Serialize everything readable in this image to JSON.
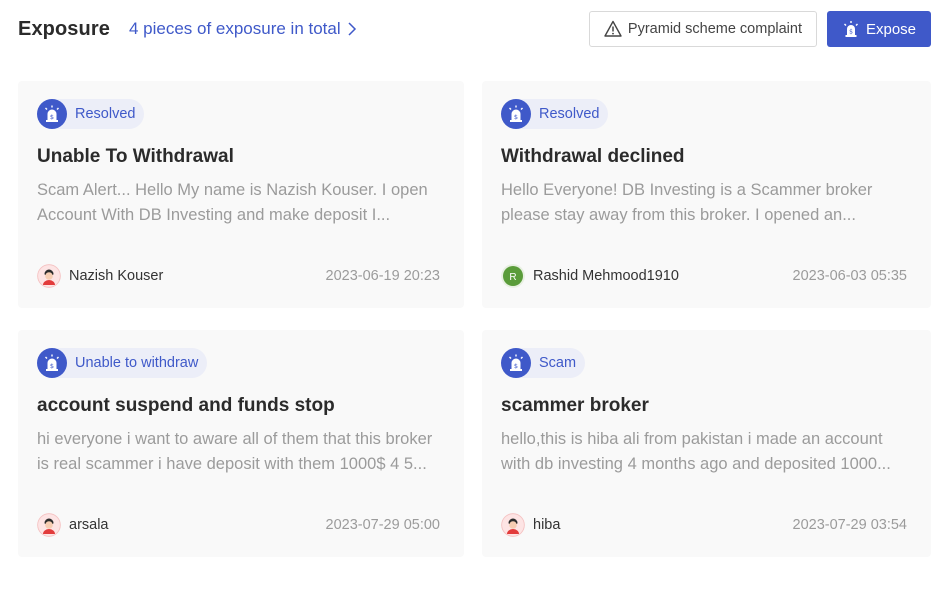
{
  "header": {
    "title": "Exposure",
    "total_link": "4 pieces of exposure in total",
    "complaint_button": "Pyramid scheme complaint",
    "expose_button": "Expose"
  },
  "colors": {
    "accent": "#3f59c9",
    "badge_bg": "#eceef8",
    "card_bg": "#f9f9f9",
    "muted_text": "#9b9b9b",
    "avatar_letter_bg": "#5a9c3a"
  },
  "cards": [
    {
      "status": "Resolved",
      "title": "Unable To Withdrawal",
      "description": "Scam Alert... Hello My name is Nazish Kouser. I open Account With DB Investing and make deposit I...",
      "author": "Nazish Kouser",
      "avatar_type": "person-icon",
      "date": "2023-06-19 20:23"
    },
    {
      "status": "Resolved",
      "title": "Withdrawal declined",
      "description": "Hello Everyone! DB Investing is a Scammer broker please stay away from this broker. I opened an...",
      "author": "Rashid Mehmood1910",
      "avatar_type": "letter",
      "avatar_letter": "R",
      "date": "2023-06-03 05:35"
    },
    {
      "status": "Unable to withdraw",
      "title": "account suspend and funds stop",
      "description": "hi everyone i want to aware all of them that this broker is real scammer i have deposit with them 1000$ 4 5...",
      "author": "arsala",
      "avatar_type": "person-icon",
      "date": "2023-07-29 05:00"
    },
    {
      "status": "Scam",
      "title": "scammer broker",
      "description": "hello,this is hiba ali from pakistan i made an account with db investing 4 months ago and deposited 1000...",
      "author": "hiba",
      "avatar_type": "person-icon",
      "date": "2023-07-29 03:54"
    }
  ]
}
